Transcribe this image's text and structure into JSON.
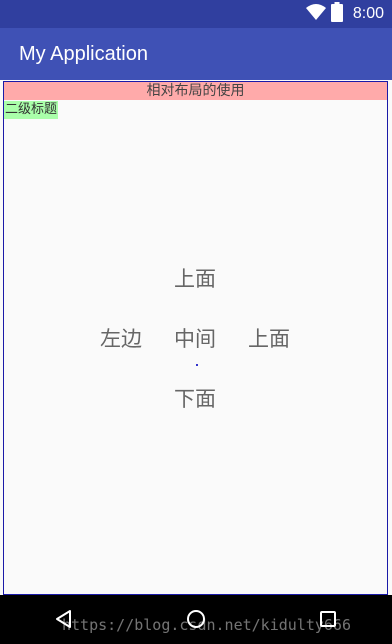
{
  "status_bar": {
    "time": "8:00",
    "icons": [
      "wifi-icon",
      "battery-icon"
    ],
    "color": "#303f9f"
  },
  "app_bar": {
    "title": "My Application",
    "color": "#3f51b5"
  },
  "content": {
    "header": "相对布局的使用",
    "subheading": "二级标题",
    "top_text": "上面",
    "left_text": "左边",
    "center_text": "中间",
    "right_text": "上面",
    "bottom_text": "下面",
    "header_color": "#ffaaaa",
    "subheading_color": "#aaffaa"
  },
  "nav_bar": {
    "buttons": [
      "back-icon",
      "home-icon",
      "recents-icon"
    ],
    "watermark": "https://blog.csdn.net/kidulty666"
  }
}
